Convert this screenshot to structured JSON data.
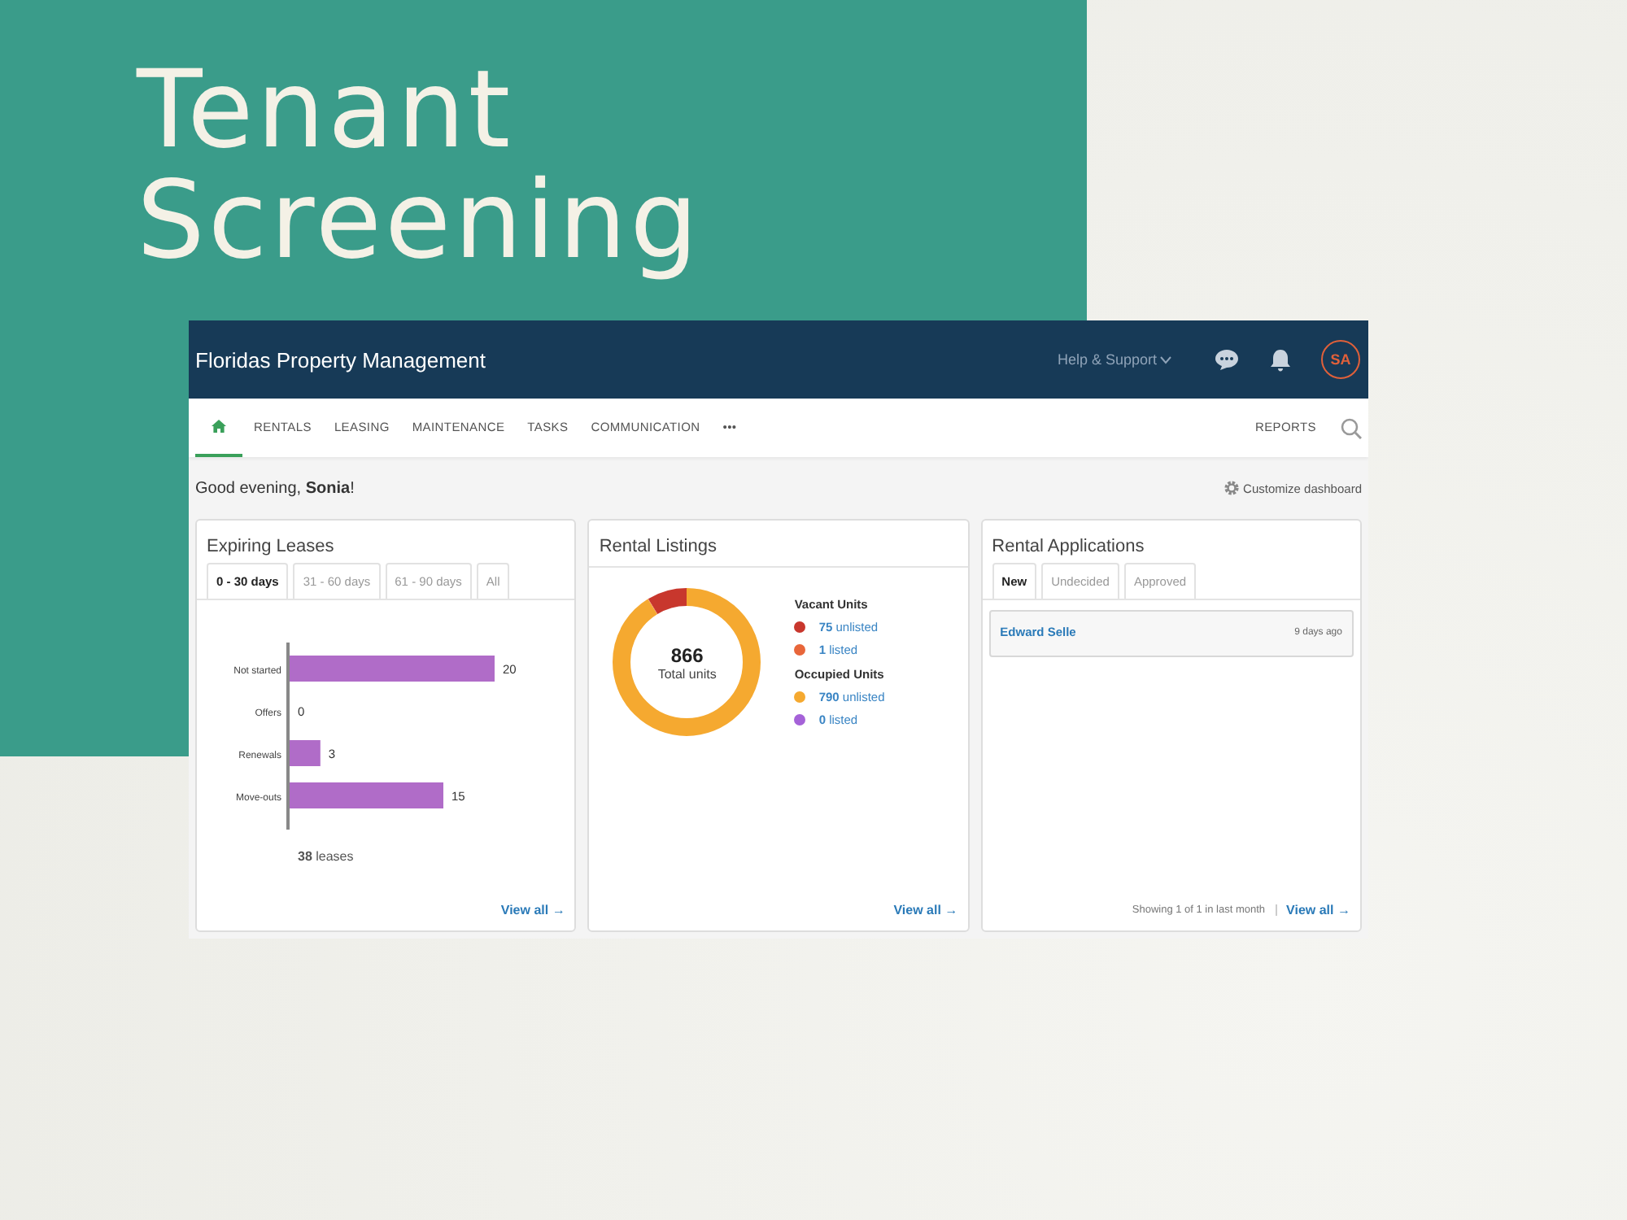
{
  "headline": "Tenant Screening",
  "app": {
    "title": "Floridas Property Management",
    "help": "Help & Support",
    "avatar": "SA",
    "nav": [
      {
        "kind": "home",
        "selected": true
      },
      {
        "label": "RENTALS",
        "selected": false
      },
      {
        "label": "LEASING",
        "selected": false
      },
      {
        "label": "MAINTENANCE",
        "selected": false
      },
      {
        "label": "TASKS",
        "selected": false
      },
      {
        "label": "COMMUNICATION",
        "selected": false
      },
      {
        "label": "•••",
        "selected": false
      }
    ],
    "reports": "REPORTS",
    "greeting": "Good evening, **Sonia**!",
    "customize": "Customize dashboard"
  },
  "expiring_leases": {
    "title": "Expiring Leases",
    "tabs": [
      {
        "label": "0 - 30 days",
        "selected": true
      },
      {
        "label": "31 - 60 days",
        "selected": false
      },
      {
        "label": "61 - 90 days",
        "selected": false
      },
      {
        "label": "All",
        "selected": false
      }
    ],
    "chart_data": {
      "type": "bar",
      "orientation": "horizontal",
      "categories": [
        "Not started",
        "Offers",
        "Renewals",
        "Move-outs"
      ],
      "values": [
        20,
        0,
        3,
        15
      ],
      "data_labels": true
    },
    "total": "**38** leases",
    "link": "View all →"
  },
  "rental_listings": {
    "title": "Rental Listings",
    "total": "866",
    "total_label": "Total units",
    "groups": [
      {
        "title": "Vacant Units",
        "items": [
          {
            "count": "75",
            "label": "unlisted",
            "color": "#c8372d"
          },
          {
            "count": "1",
            "label": "listed",
            "color": "#e8663a"
          }
        ]
      },
      {
        "title": "Occupied Units",
        "items": [
          {
            "count": "790",
            "label": "unlisted",
            "color": "#f5a930"
          },
          {
            "count": "0",
            "label": "listed",
            "color": "#a562d8"
          }
        ]
      }
    ],
    "link": "View all →"
  },
  "rental_applications": {
    "title": "Rental Applications",
    "tabs": [
      {
        "label": "New",
        "selected": true
      },
      {
        "label": "Undecided",
        "selected": false
      },
      {
        "label": "Approved",
        "selected": false
      }
    ],
    "rows": [
      {
        "name": "Edward Selle",
        "time": "9 days ago"
      }
    ],
    "footer": "Showing 1 of 1 in last month",
    "link": "View all →"
  }
}
